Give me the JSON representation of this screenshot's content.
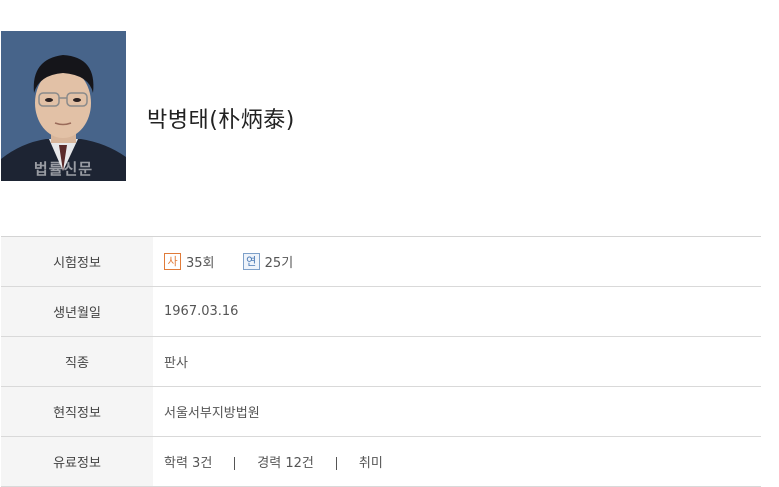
{
  "profile": {
    "name": "박병태(朴炳泰)",
    "photo_watermark": "법률신문"
  },
  "rows": {
    "exam": {
      "label": "시험정보",
      "items": [
        {
          "badge": "사",
          "value": "35회",
          "color": "#e07b39"
        },
        {
          "badge": "연",
          "value": "25기",
          "color": "#4a7ab5"
        }
      ]
    },
    "birth": {
      "label": "생년월일",
      "value": "1967.03.16"
    },
    "job": {
      "label": "직종",
      "value": "판사"
    },
    "position": {
      "label": "현직정보",
      "value": "서울서부지방법원"
    },
    "paid": {
      "label": "유료정보",
      "links": [
        "학력 3건",
        "경력 12건",
        "취미"
      ]
    }
  }
}
